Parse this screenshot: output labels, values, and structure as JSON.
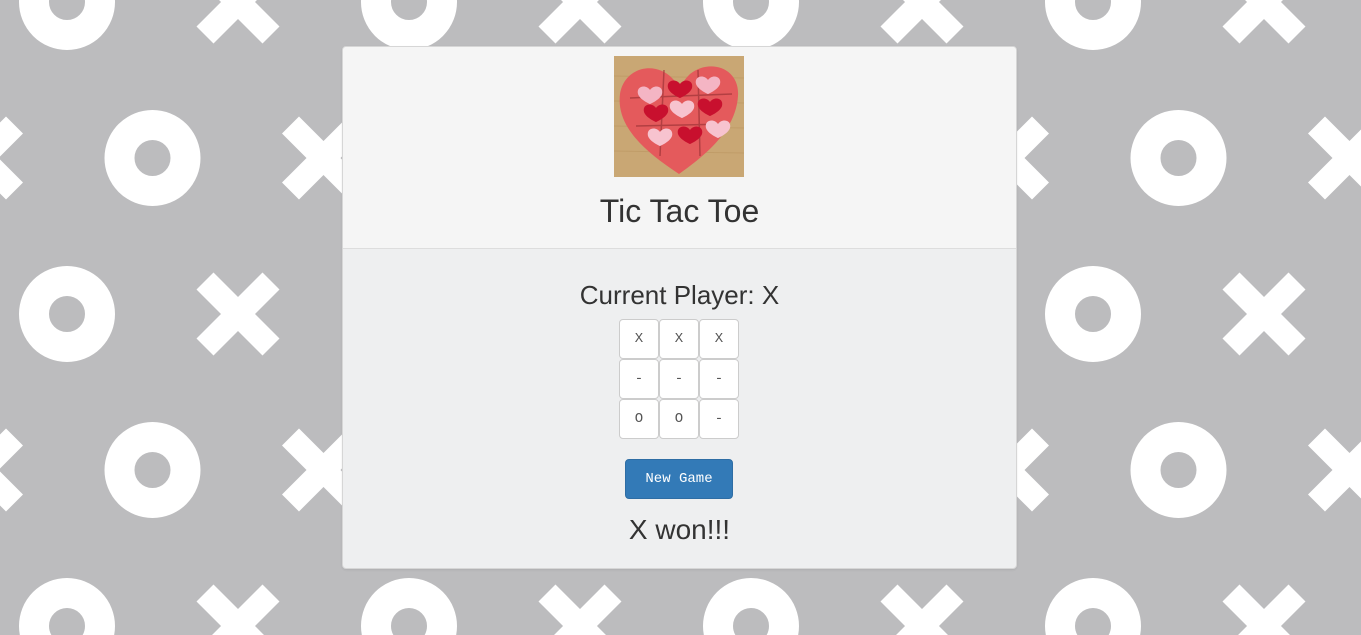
{
  "page": {
    "background_color": "#bcbcbe",
    "pattern_color": "#ffffff",
    "pattern_icons": [
      "o-icon",
      "x-icon"
    ]
  },
  "header": {
    "logo_icon": "heart-tic-tac-toe-image",
    "title": "Tic Tac Toe"
  },
  "game": {
    "status_prefix": "Current Player: ",
    "current_player": "X",
    "board": [
      [
        "X",
        "X",
        "X"
      ],
      [
        "-",
        "-",
        "-"
      ],
      [
        "O",
        "O",
        "-"
      ]
    ],
    "new_game_label": "New Game",
    "result": "X won!!!"
  },
  "colors": {
    "button": "#337ab7",
    "panel_header": "#f5f5f5",
    "panel_body": "#eeeff0"
  }
}
